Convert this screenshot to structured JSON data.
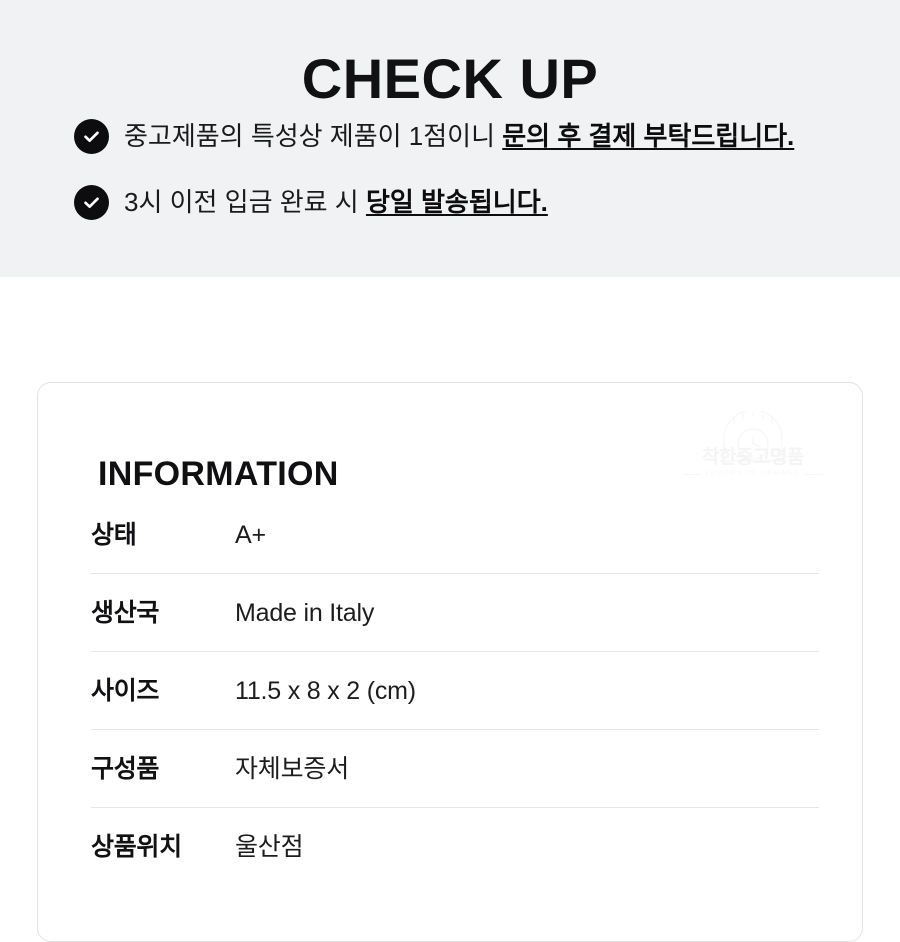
{
  "checkup": {
    "title": "CHECK UP",
    "bullets": [
      {
        "icon": "check-circle-icon",
        "plain_before": "중고제품의 특성상 제품이 1점이니 ",
        "emphasis": "문의 후 결제 부탁드립니다."
      },
      {
        "icon": "check-circle-icon",
        "plain_before": "3시 이전 입금 완료 시 ",
        "emphasis": "당일 발송됩니다."
      }
    ]
  },
  "information": {
    "heading": "INFORMATION",
    "watermark": {
      "icon": "dome-clock-logo-icon",
      "brand": "착한중고명품",
      "tagline": "LUXURY IN DEMAND"
    },
    "rows": [
      {
        "label": "상태",
        "value": "A+"
      },
      {
        "label": "생산국",
        "value": "Made in Italy"
      },
      {
        "label": "사이즈",
        "value": "11.5 x 8 x 2 (cm)"
      },
      {
        "label": "구성품",
        "value": "자체보증서"
      },
      {
        "label": "상품위치",
        "value": "울산점"
      }
    ]
  },
  "colors": {
    "band_background": "#f1f2f4",
    "page_background": "#ffffff",
    "text_primary": "#111114",
    "badge_fill": "#0d0d0f",
    "badge_check": "#ffffff",
    "divider": "#e6e6e8",
    "card_border": "#e3e3e5",
    "watermark": "#ececed"
  }
}
